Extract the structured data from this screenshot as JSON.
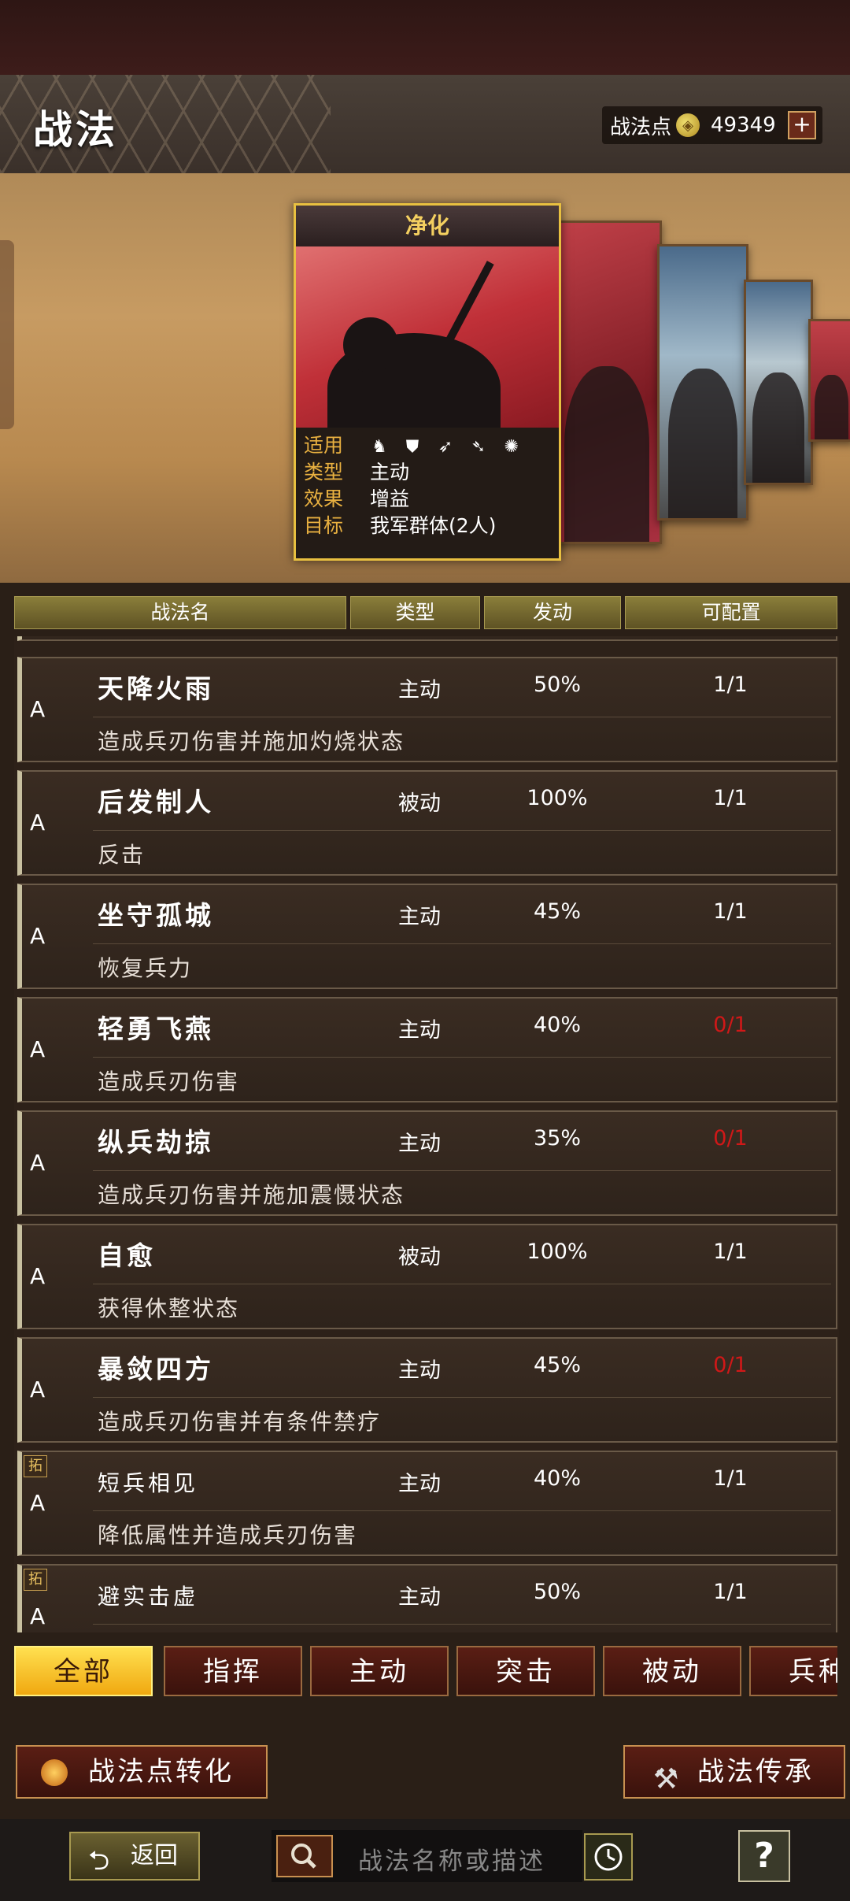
{
  "header": {
    "title": "战法",
    "points_label": "战法点",
    "points_value": "49349",
    "plus_label": "+"
  },
  "featured": {
    "name": "净化",
    "rows": [
      {
        "key": "适用",
        "value": ""
      },
      {
        "key": "类型",
        "value": "主动"
      },
      {
        "key": "效果",
        "value": "增益"
      },
      {
        "key": "目标",
        "value": "我军群体(2人)"
      }
    ],
    "troop_icons": [
      "cavalry-icon",
      "shield-icon",
      "bow-icon",
      "spear-icon",
      "wheel-icon"
    ]
  },
  "columns": {
    "name": "战法名",
    "type": "类型",
    "trigger": "发动",
    "config": "可配置"
  },
  "skills": [
    {
      "grade": "A",
      "tag": "",
      "name": "天降火雨",
      "type": "主动",
      "rate": "50%",
      "config": "1/1",
      "config_color": "#ffffff",
      "desc": "造成兵刃伤害并施加灼烧状态"
    },
    {
      "grade": "A",
      "tag": "",
      "name": "后发制人",
      "type": "被动",
      "rate": "100%",
      "config": "1/1",
      "config_color": "#ffffff",
      "desc": "反击"
    },
    {
      "grade": "A",
      "tag": "",
      "name": "坐守孤城",
      "type": "主动",
      "rate": "45%",
      "config": "1/1",
      "config_color": "#ffffff",
      "desc": "恢复兵力"
    },
    {
      "grade": "A",
      "tag": "",
      "name": "轻勇飞燕",
      "type": "主动",
      "rate": "40%",
      "config": "0/1",
      "config_color": "#d01818",
      "desc": "造成兵刃伤害"
    },
    {
      "grade": "A",
      "tag": "",
      "name": "纵兵劫掠",
      "type": "主动",
      "rate": "35%",
      "config": "0/1",
      "config_color": "#d01818",
      "desc": "造成兵刃伤害并施加震慑状态"
    },
    {
      "grade": "A",
      "tag": "",
      "name": "自愈",
      "type": "被动",
      "rate": "100%",
      "config": "1/1",
      "config_color": "#ffffff",
      "desc": "获得休整状态"
    },
    {
      "grade": "A",
      "tag": "",
      "name": "暴敛四方",
      "type": "主动",
      "rate": "45%",
      "config": "0/1",
      "config_color": "#d01818",
      "desc": "造成兵刃伤害并有条件禁疗"
    },
    {
      "grade": "A",
      "tag": "拓",
      "name": "短兵相见",
      "type": "主动",
      "rate": "40%",
      "config": "1/1",
      "config_color": "#ffffff",
      "desc": "降低属性并造成兵刃伤害"
    },
    {
      "grade": "A",
      "tag": "拓",
      "name": "避实击虚",
      "type": "主动",
      "rate": "50%",
      "config": "1/1",
      "config_color": "#ffffff",
      "desc": ""
    }
  ],
  "filter_tabs": [
    "全部",
    "指挥",
    "主动",
    "突击",
    "被动",
    "兵种"
  ],
  "actions": {
    "convert": "战法点转化",
    "inherit": "战法传承"
  },
  "bottom": {
    "back": "返回",
    "search_placeholder": "战法名称或描述",
    "help": "?"
  }
}
